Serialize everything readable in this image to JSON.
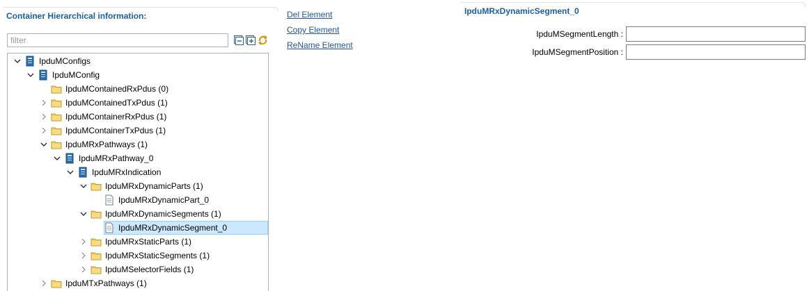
{
  "left": {
    "title": "Container Hierarchical information:",
    "filter_placeholder": "filter",
    "tools": {
      "collapse_icon": "collapse-all-icon",
      "expand_icon": "expand-all-icon",
      "sync_icon": "sync-icon"
    },
    "tree": [
      {
        "label": "IpduMConfigs",
        "level": 0,
        "expander": "expanded",
        "icon": "module"
      },
      {
        "label": "IpduMConfig",
        "level": 1,
        "expander": "expanded",
        "icon": "module"
      },
      {
        "label": "IpduMContainedRxPdus (0)",
        "level": 2,
        "expander": "none",
        "icon": "folder"
      },
      {
        "label": "IpduMContainedTxPdus (1)",
        "level": 2,
        "expander": "collapsed",
        "icon": "folder"
      },
      {
        "label": "IpduMContainerRxPdus (1)",
        "level": 2,
        "expander": "collapsed",
        "icon": "folder"
      },
      {
        "label": "IpduMContainerTxPdus (1)",
        "level": 2,
        "expander": "collapsed",
        "icon": "folder"
      },
      {
        "label": "IpduMRxPathways (1)",
        "level": 2,
        "expander": "expanded",
        "icon": "folder"
      },
      {
        "label": "IpduMRxPathway_0",
        "level": 3,
        "expander": "expanded",
        "icon": "module"
      },
      {
        "label": "IpduMRxIndication",
        "level": 4,
        "expander": "expanded",
        "icon": "module"
      },
      {
        "label": "IpduMRxDynamicParts (1)",
        "level": 5,
        "expander": "expanded",
        "icon": "folder"
      },
      {
        "label": "IpduMRxDynamicPart_0",
        "level": 6,
        "expander": "none",
        "icon": "doc"
      },
      {
        "label": "IpduMRxDynamicSegments (1)",
        "level": 5,
        "expander": "expanded",
        "icon": "folder"
      },
      {
        "label": "IpduMRxDynamicSegment_0",
        "level": 6,
        "expander": "none",
        "icon": "doc",
        "selected": true
      },
      {
        "label": "IpduMRxStaticParts (1)",
        "level": 5,
        "expander": "collapsed",
        "icon": "folder"
      },
      {
        "label": "IpduMRxStaticSegments (1)",
        "level": 5,
        "expander": "collapsed",
        "icon": "folder"
      },
      {
        "label": "IpduMSelectorFields (1)",
        "level": 5,
        "expander": "collapsed",
        "icon": "folder"
      },
      {
        "label": "IpduMTxPathways (1)",
        "level": 2,
        "expander": "collapsed",
        "icon": "folder"
      }
    ]
  },
  "actions": {
    "del": "Del Element",
    "copy": "Copy Element",
    "rename": "ReName Element"
  },
  "right": {
    "title": "IpduMRxDynamicSegment_0",
    "fields": {
      "length_label": "IpduMSegmentLength :",
      "length_value": "",
      "position_label": "IpduMSegmentPosition :",
      "position_value": ""
    }
  },
  "colors": {
    "title_blue": "#1a5fa8",
    "link_blue": "#1f55a8",
    "selection_bg": "#cce8ff",
    "folder_yellow": "#f3c95a",
    "module_blue": "#2b6cb0"
  }
}
